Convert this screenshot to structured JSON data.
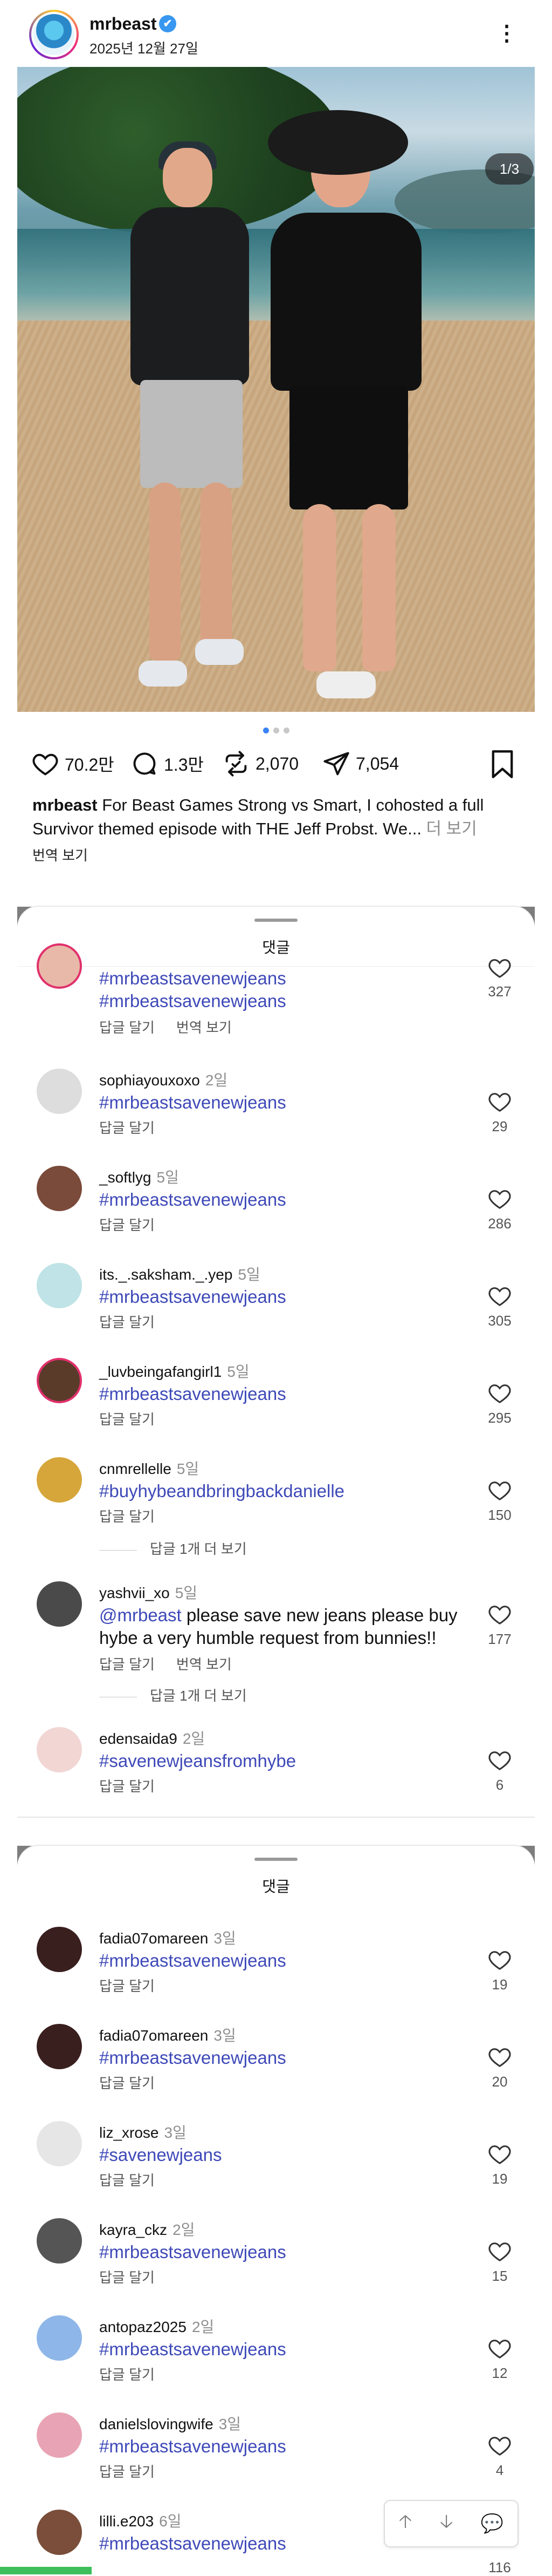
{
  "header": {
    "username": "mrbeast",
    "verified_mark": "✔",
    "date": "2025년 12월 27일",
    "more_icon": "⋮"
  },
  "photo": {
    "counter": "1/3",
    "slides": 3,
    "active_slide": 1
  },
  "actions": {
    "likes": "70.2만",
    "comments": "1.3만",
    "reposts": "2,070",
    "shares": "7,054"
  },
  "caption": {
    "username": "mrbeast",
    "text": " For Beast Games Strong vs Smart, I cohosted a full Survivor themed episode with THE Jeff Probst. We...",
    "more": " 더 보기",
    "translate": "번역 보기"
  },
  "sheet1": {
    "title": "댓글",
    "comments": [
      {
        "user": "",
        "time": "",
        "text": "#mrbeastsavenewjeans #mrbeastsavenewjeans",
        "reply": "답글 달기",
        "translate": "번역 보기",
        "likes": "327"
      },
      {
        "user": "sophiayouxoxo",
        "time": "2일",
        "text": "#mrbeastsavenewjeans",
        "reply": "답글 달기",
        "likes": "29"
      },
      {
        "user": "_softlyg",
        "time": "5일",
        "text": "#mrbeastsavenewjeans",
        "reply": "답글 달기",
        "likes": "286"
      },
      {
        "user": "its._.saksham._.yep",
        "time": "5일",
        "text": "#mrbeastsavenewjeans",
        "reply": "답글 달기",
        "likes": "305"
      },
      {
        "user": "_luvbeingafangirl1",
        "time": "5일",
        "text": "#mrbeastsavenewjeans",
        "reply": "답글 달기",
        "likes": "295"
      },
      {
        "user": "cnmrellelle",
        "time": "5일",
        "text": "#buyhybeandbringbackdanielle",
        "reply": "답글 달기",
        "likes": "150",
        "more_replies": "답글 1개 더 보기"
      },
      {
        "user": "yashvii_xo",
        "time": "5일",
        "mention": "@mrbeast",
        "text": " please save new jeans please buy hybe a very humble request from bunnies!!",
        "reply": "답글 달기",
        "translate": "번역 보기",
        "likes": "177",
        "more_replies": "답글 1개 더 보기"
      },
      {
        "user": "edensaida9",
        "time": "2일",
        "text": "#savenewjeansfromhybe",
        "reply": "답글 달기",
        "likes": "6"
      }
    ]
  },
  "sheet2": {
    "title": "댓글",
    "comments": [
      {
        "user": "fadia07omareen",
        "time": "3일",
        "text": "#mrbeastsavenewjeans",
        "reply": "답글 달기",
        "likes": "19"
      },
      {
        "user": "fadia07omareen",
        "time": "3일",
        "text": "#mrbeastsavenewjeans",
        "reply": "답글 달기",
        "likes": "20"
      },
      {
        "user": "liz_xrose",
        "time": "3일",
        "text": "#savenewjeans",
        "reply": "답글 달기",
        "likes": "19"
      },
      {
        "user": "kayra_ckz",
        "time": "2일",
        "text": "#mrbeastsavenewjeans",
        "reply": "답글 달기",
        "likes": "15"
      },
      {
        "user": "antopaz2025",
        "time": "2일",
        "text": "#mrbeastsavenewjeans",
        "reply": "답글 달기",
        "likes": "12"
      },
      {
        "user": "danielslovingwife",
        "time": "3일",
        "text": "#mrbeastsavenewjeans",
        "reply": "답글 달기",
        "likes": "4"
      },
      {
        "user": "lilli.e203",
        "time": "6일",
        "text": "#mrbeastsavenewjeans",
        "reply": "",
        "likes": "116"
      }
    ]
  },
  "nav": {
    "up": "🡡",
    "down": "🡣",
    "chat": "💬"
  },
  "colors": {
    "accent": "#3e49b8",
    "verified": "#3897f0",
    "dot_active": "#3b82f6"
  }
}
